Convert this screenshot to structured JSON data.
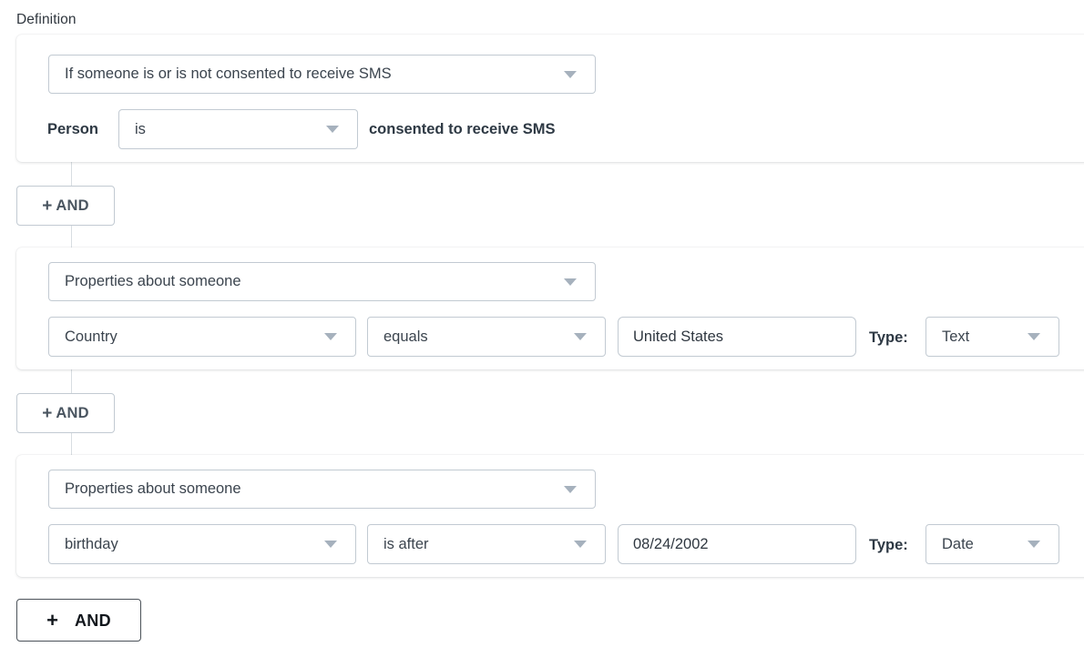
{
  "section": {
    "heading": "Definition"
  },
  "connector_color": "#d8dde2",
  "conditions": [
    {
      "type_select": {
        "value": "If someone is or is not consented to receive SMS",
        "caret": "chevron-down-icon"
      },
      "prefix_label": "Person",
      "operator_select": {
        "value": "is",
        "caret": "chevron-down-icon"
      },
      "suffix_label": "consented to receive SMS"
    },
    {
      "type_select": {
        "value": "Properties about someone",
        "caret": "chevron-down-icon"
      },
      "property_select": {
        "value": "Country",
        "caret": "chevron-down-icon"
      },
      "comparator_select": {
        "value": "equals",
        "caret": "chevron-down-icon"
      },
      "value_input": {
        "value": "United States",
        "placeholder": "Value"
      },
      "type_label": "Type:",
      "datatype_select": {
        "value": "Text",
        "caret": "chevron-down-icon"
      }
    },
    {
      "type_select": {
        "value": "Properties about someone",
        "caret": "chevron-down-icon"
      },
      "property_select": {
        "value": "birthday",
        "caret": "chevron-down-icon"
      },
      "comparator_select": {
        "value": "is after",
        "caret": "chevron-down-icon"
      },
      "value_input": {
        "value": "08/24/2002",
        "placeholder": "Value"
      },
      "type_label": "Type:",
      "datatype_select": {
        "value": "Date",
        "caret": "chevron-down-icon"
      }
    }
  ],
  "and_buttons": [
    {
      "plus": "+",
      "label": "AND"
    },
    {
      "plus": "+",
      "label": "AND"
    },
    {
      "plus": "+",
      "label": "AND"
    }
  ]
}
